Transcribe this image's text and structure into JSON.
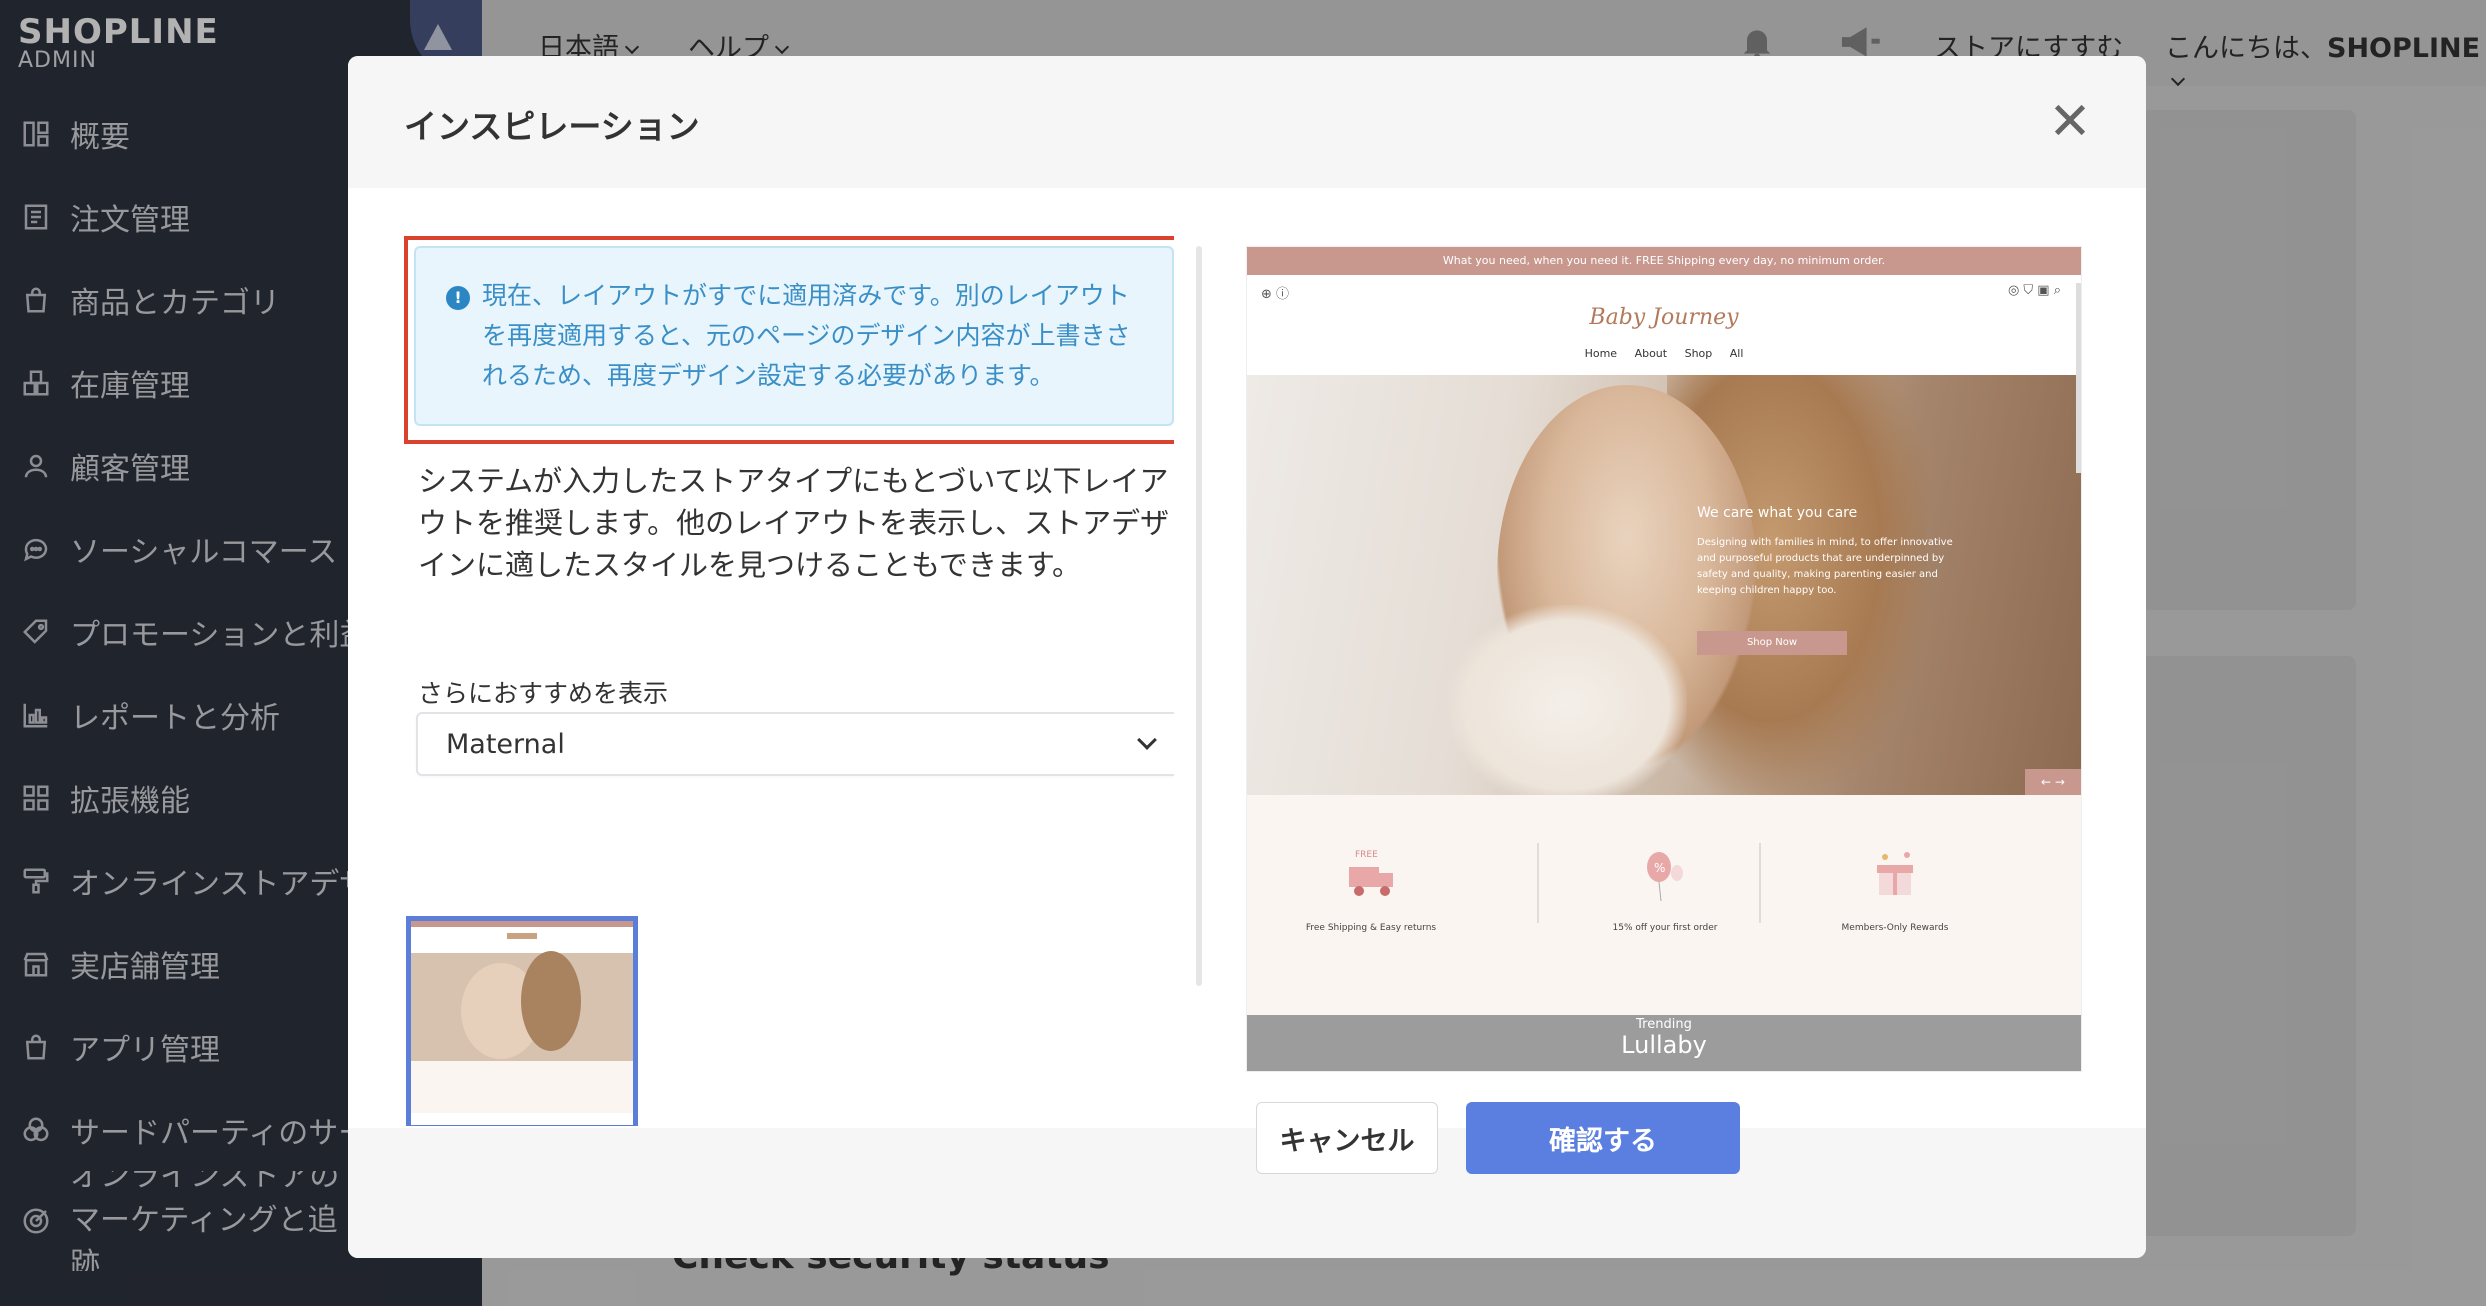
{
  "sidebar": {
    "logo_name": "SHOPLINE",
    "logo_sub": "ADMIN",
    "items": [
      {
        "label": "概要",
        "icon": "overview-icon"
      },
      {
        "label": "注文管理",
        "icon": "order-icon"
      },
      {
        "label": "商品とカテゴリ",
        "icon": "bag-icon"
      },
      {
        "label": "在庫管理",
        "icon": "inventory-icon"
      },
      {
        "label": "顧客管理",
        "icon": "customer-icon"
      },
      {
        "label": "ソーシャルコマース",
        "icon": "chat-icon"
      },
      {
        "label": "プロモーションと利益",
        "icon": "tag-icon"
      },
      {
        "label": "レポートと分析",
        "icon": "chart-icon"
      },
      {
        "label": "拡張機能",
        "icon": "grid-icon"
      },
      {
        "label": "オンラインストアデザイン",
        "icon": "brush-icon"
      },
      {
        "label": "実店舗管理",
        "icon": "store-icon"
      },
      {
        "label": "アプリ管理",
        "icon": "bag-icon"
      },
      {
        "label": "サードパーティのサービス",
        "icon": "circles-icon"
      },
      {
        "label": "オンラインストアのマーケティングと追跡",
        "icon": "target-icon"
      }
    ]
  },
  "topbar": {
    "language": "日本語",
    "help": "ヘルプ",
    "recommend": "ストアにすすむ",
    "greeting": "こんにちは、",
    "user": "SHOPLINE"
  },
  "background": {
    "section_title": "Check security status"
  },
  "modal": {
    "title": "インスピレーション",
    "alert_text": "現在、レイアウトがすでに適用済みです。別のレイアウトを再度適用すると、元のページのデザイン内容が上書きされるため、再度デザイン設定する必要があります。",
    "description": "システムが入力したストアタイプにもとづいて以下レイアウトを推奨します。他のレイアウトを表示し、ストアデザインに適したスタイルを見つけることもできます。",
    "more_label": "さらにおすすめを表示",
    "select_value": "Maternal",
    "cancel_label": "キャンセル",
    "confirm_label": "確認する"
  },
  "preview": {
    "banner": "What you need, when you need it. FREE Shipping every day, no minimum order.",
    "brand": "Baby Journey",
    "nav": [
      "Home",
      "About",
      "Shop All"
    ],
    "hero_heading": "We care what you care",
    "hero_text": "Designing with families in mind, to offer innovative and purposeful products that are underpinned by safety and quality, making parenting easier and keeping children happy too.",
    "shop_button": "Shop Now",
    "features": [
      {
        "badge": "FREE",
        "label": "Free Shipping & Easy returns"
      },
      {
        "badge": "%",
        "label": "15% off your first order"
      },
      {
        "badge": "",
        "label": "Members-Only Rewards"
      }
    ],
    "trend_small": "Trending",
    "trend_big": "Lullaby"
  },
  "colors": {
    "sidebar_bg": "#2f3440",
    "accent": "#5a7fe0",
    "alert_border": "#d9432e",
    "alert_text": "#3a8fc7",
    "preview_accent": "#c8988f"
  }
}
